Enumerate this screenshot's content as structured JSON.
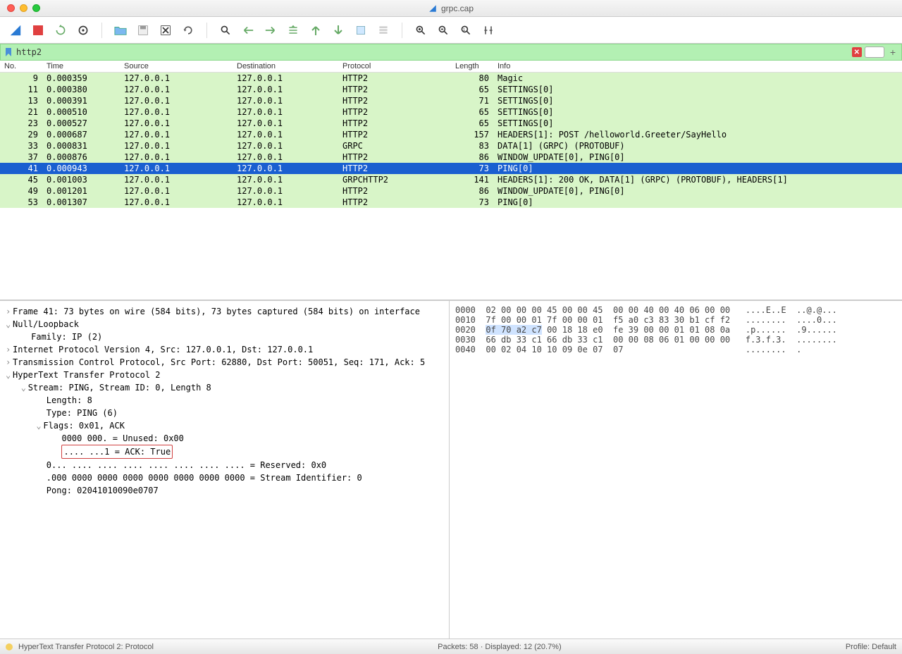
{
  "window": {
    "title": "grpc.cap"
  },
  "filter": {
    "value": "http2"
  },
  "columns": {
    "no": "No.",
    "time": "Time",
    "source": "Source",
    "destination": "Destination",
    "protocol": "Protocol",
    "length": "Length",
    "info": "Info"
  },
  "packets": [
    {
      "no": "9",
      "time": "0.000359",
      "src": "127.0.0.1",
      "dst": "127.0.0.1",
      "proto": "HTTP2",
      "len": "80",
      "info": "Magic",
      "sel": false
    },
    {
      "no": "11",
      "time": "0.000380",
      "src": "127.0.0.1",
      "dst": "127.0.0.1",
      "proto": "HTTP2",
      "len": "65",
      "info": "SETTINGS[0]",
      "sel": false
    },
    {
      "no": "13",
      "time": "0.000391",
      "src": "127.0.0.1",
      "dst": "127.0.0.1",
      "proto": "HTTP2",
      "len": "71",
      "info": "SETTINGS[0]",
      "sel": false
    },
    {
      "no": "21",
      "time": "0.000510",
      "src": "127.0.0.1",
      "dst": "127.0.0.1",
      "proto": "HTTP2",
      "len": "65",
      "info": "SETTINGS[0]",
      "sel": false
    },
    {
      "no": "23",
      "time": "0.000527",
      "src": "127.0.0.1",
      "dst": "127.0.0.1",
      "proto": "HTTP2",
      "len": "65",
      "info": "SETTINGS[0]",
      "sel": false
    },
    {
      "no": "29",
      "time": "0.000687",
      "src": "127.0.0.1",
      "dst": "127.0.0.1",
      "proto": "HTTP2",
      "len": "157",
      "info": "HEADERS[1]: POST /helloworld.Greeter/SayHello",
      "sel": false
    },
    {
      "no": "33",
      "time": "0.000831",
      "src": "127.0.0.1",
      "dst": "127.0.0.1",
      "proto": "GRPC",
      "len": "83",
      "info": "DATA[1] (GRPC) (PROTOBUF)",
      "sel": false
    },
    {
      "no": "37",
      "time": "0.000876",
      "src": "127.0.0.1",
      "dst": "127.0.0.1",
      "proto": "HTTP2",
      "len": "86",
      "info": "WINDOW_UPDATE[0], PING[0]",
      "sel": false
    },
    {
      "no": "41",
      "time": "0.000943",
      "src": "127.0.0.1",
      "dst": "127.0.0.1",
      "proto": "HTTP2",
      "len": "73",
      "info": "PING[0]",
      "sel": true
    },
    {
      "no": "45",
      "time": "0.001003",
      "src": "127.0.0.1",
      "dst": "127.0.0.1",
      "proto": "GRPCHTTP2",
      "len": "141",
      "info": "HEADERS[1]: 200 OK, DATA[1] (GRPC) (PROTOBUF), HEADERS[1]",
      "sel": false
    },
    {
      "no": "49",
      "time": "0.001201",
      "src": "127.0.0.1",
      "dst": "127.0.0.1",
      "proto": "HTTP2",
      "len": "86",
      "info": "WINDOW_UPDATE[0], PING[0]",
      "sel": false
    },
    {
      "no": "53",
      "time": "0.001307",
      "src": "127.0.0.1",
      "dst": "127.0.0.1",
      "proto": "HTTP2",
      "len": "73",
      "info": "PING[0]",
      "sel": false
    }
  ],
  "details": {
    "l0": "Frame 41: 73 bytes on wire (584 bits), 73 bytes captured (584 bits) on interface",
    "l1": "Null/Loopback",
    "l2": "Family: IP (2)",
    "l3": "Internet Protocol Version 4, Src: 127.0.0.1, Dst: 127.0.0.1",
    "l4": "Transmission Control Protocol, Src Port: 62880, Dst Port: 50051, Seq: 171, Ack: 5",
    "l5": "HyperText Transfer Protocol 2",
    "l6": "Stream: PING, Stream ID: 0, Length 8",
    "l7": "Length: 8",
    "l8": "Type: PING (6)",
    "l9": "Flags: 0x01, ACK",
    "l10": "0000 000. = Unused: 0x00",
    "l11": ".... ...1 = ACK: True",
    "l12": "0... .... .... .... .... .... .... .... = Reserved: 0x0",
    "l13": ".000 0000 0000 0000 0000 0000 0000 0000 = Stream Identifier: 0",
    "l14": "Pong: 02041010090e0707"
  },
  "hex": {
    "r0o": "0000",
    "r0h": "02 00 00 00 45 00 00 45  00 00 40 00 40 06 00 00",
    "r0a": "....E..E  ..@.@...",
    "r1o": "0010",
    "r1h": "7f 00 00 01 7f 00 00 01  f5 a0 c3 83 30 b1 cf f2",
    "r1a": "........  ....0...",
    "r2o": "0020",
    "r2h1": "0f 70 a2 c7",
    "r2h2": " 00 18 18 e0  fe 39 00 00 01 01 08 0a",
    "r2a": ".p......  .9......",
    "r3o": "0030",
    "r3h": "66 db 33 c1 66 db 33 c1  00 00 08 06 01 00 00 00",
    "r3a": "f.3.f.3.  ........",
    "r4o": "0040",
    "r4h": "00 02 04 10 10 09 0e 07  07",
    "r4a": "........  ."
  },
  "status": {
    "left": "HyperText Transfer Protocol 2: Protocol",
    "mid": "Packets: 58 · Displayed: 12 (20.7%)",
    "right": "Profile: Default"
  }
}
